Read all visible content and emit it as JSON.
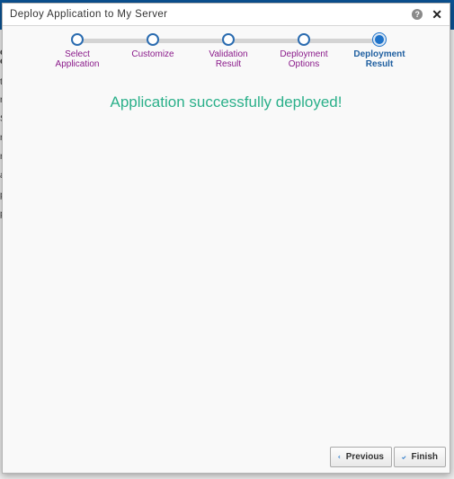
{
  "dialog": {
    "title": "Deploy Application to My Server",
    "help_glyph": "?",
    "close_glyph": "✕"
  },
  "steps": [
    {
      "label_line1": "Select",
      "label_line2": "Application",
      "state": "done"
    },
    {
      "label_line1": "Customize",
      "label_line2": "",
      "state": "done"
    },
    {
      "label_line1": "Validation",
      "label_line2": "Result",
      "state": "done"
    },
    {
      "label_line1": "Deployment",
      "label_line2": "Options",
      "state": "done"
    },
    {
      "label_line1": "Deployment",
      "label_line2": "Result",
      "state": "active"
    }
  ],
  "main": {
    "message": "Application successfully deployed!"
  },
  "footer": {
    "previous_label": "Previous",
    "finish_label": "Finish"
  },
  "background": {
    "fragments": [
      "c",
      "e",
      "ti",
      "r",
      "S",
      "r",
      "r",
      "a",
      "p",
      "p"
    ]
  },
  "colors": {
    "accent": "#1f73c9",
    "success": "#2bb08a",
    "step_label": "#8a1a8a"
  },
  "icons": {
    "help": "help-icon",
    "close": "close-icon",
    "previous": "chevron-left-icon",
    "finish": "checkmark-icon"
  }
}
